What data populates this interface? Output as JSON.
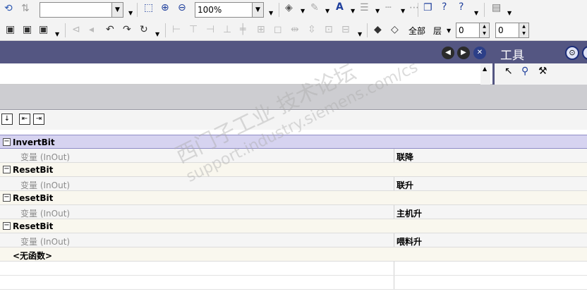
{
  "toolbar1": {
    "font_combo_value": "",
    "zoom_value": "100%"
  },
  "toolbar2": {
    "all_label": "全部",
    "layer_label": "层",
    "spin1_value": "0",
    "spin2_value": "0"
  },
  "tools_panel": {
    "title": "工具"
  },
  "table": {
    "rows": [
      {
        "name": "InvertBit",
        "param": "变量 (InOut)",
        "value": "联降"
      },
      {
        "name": "ResetBit",
        "param": "变量 (InOut)",
        "value": "联升"
      },
      {
        "name": "ResetBit",
        "param": "变量 (InOut)",
        "value": "主机升"
      },
      {
        "name": "ResetBit",
        "param": "变量 (InOut)",
        "value": "喂料升"
      }
    ],
    "no_function": "<无函数>"
  },
  "watermark": {
    "line1": "西门子工业 技术论坛",
    "line2": "support.industry.siemens.com/cs"
  }
}
